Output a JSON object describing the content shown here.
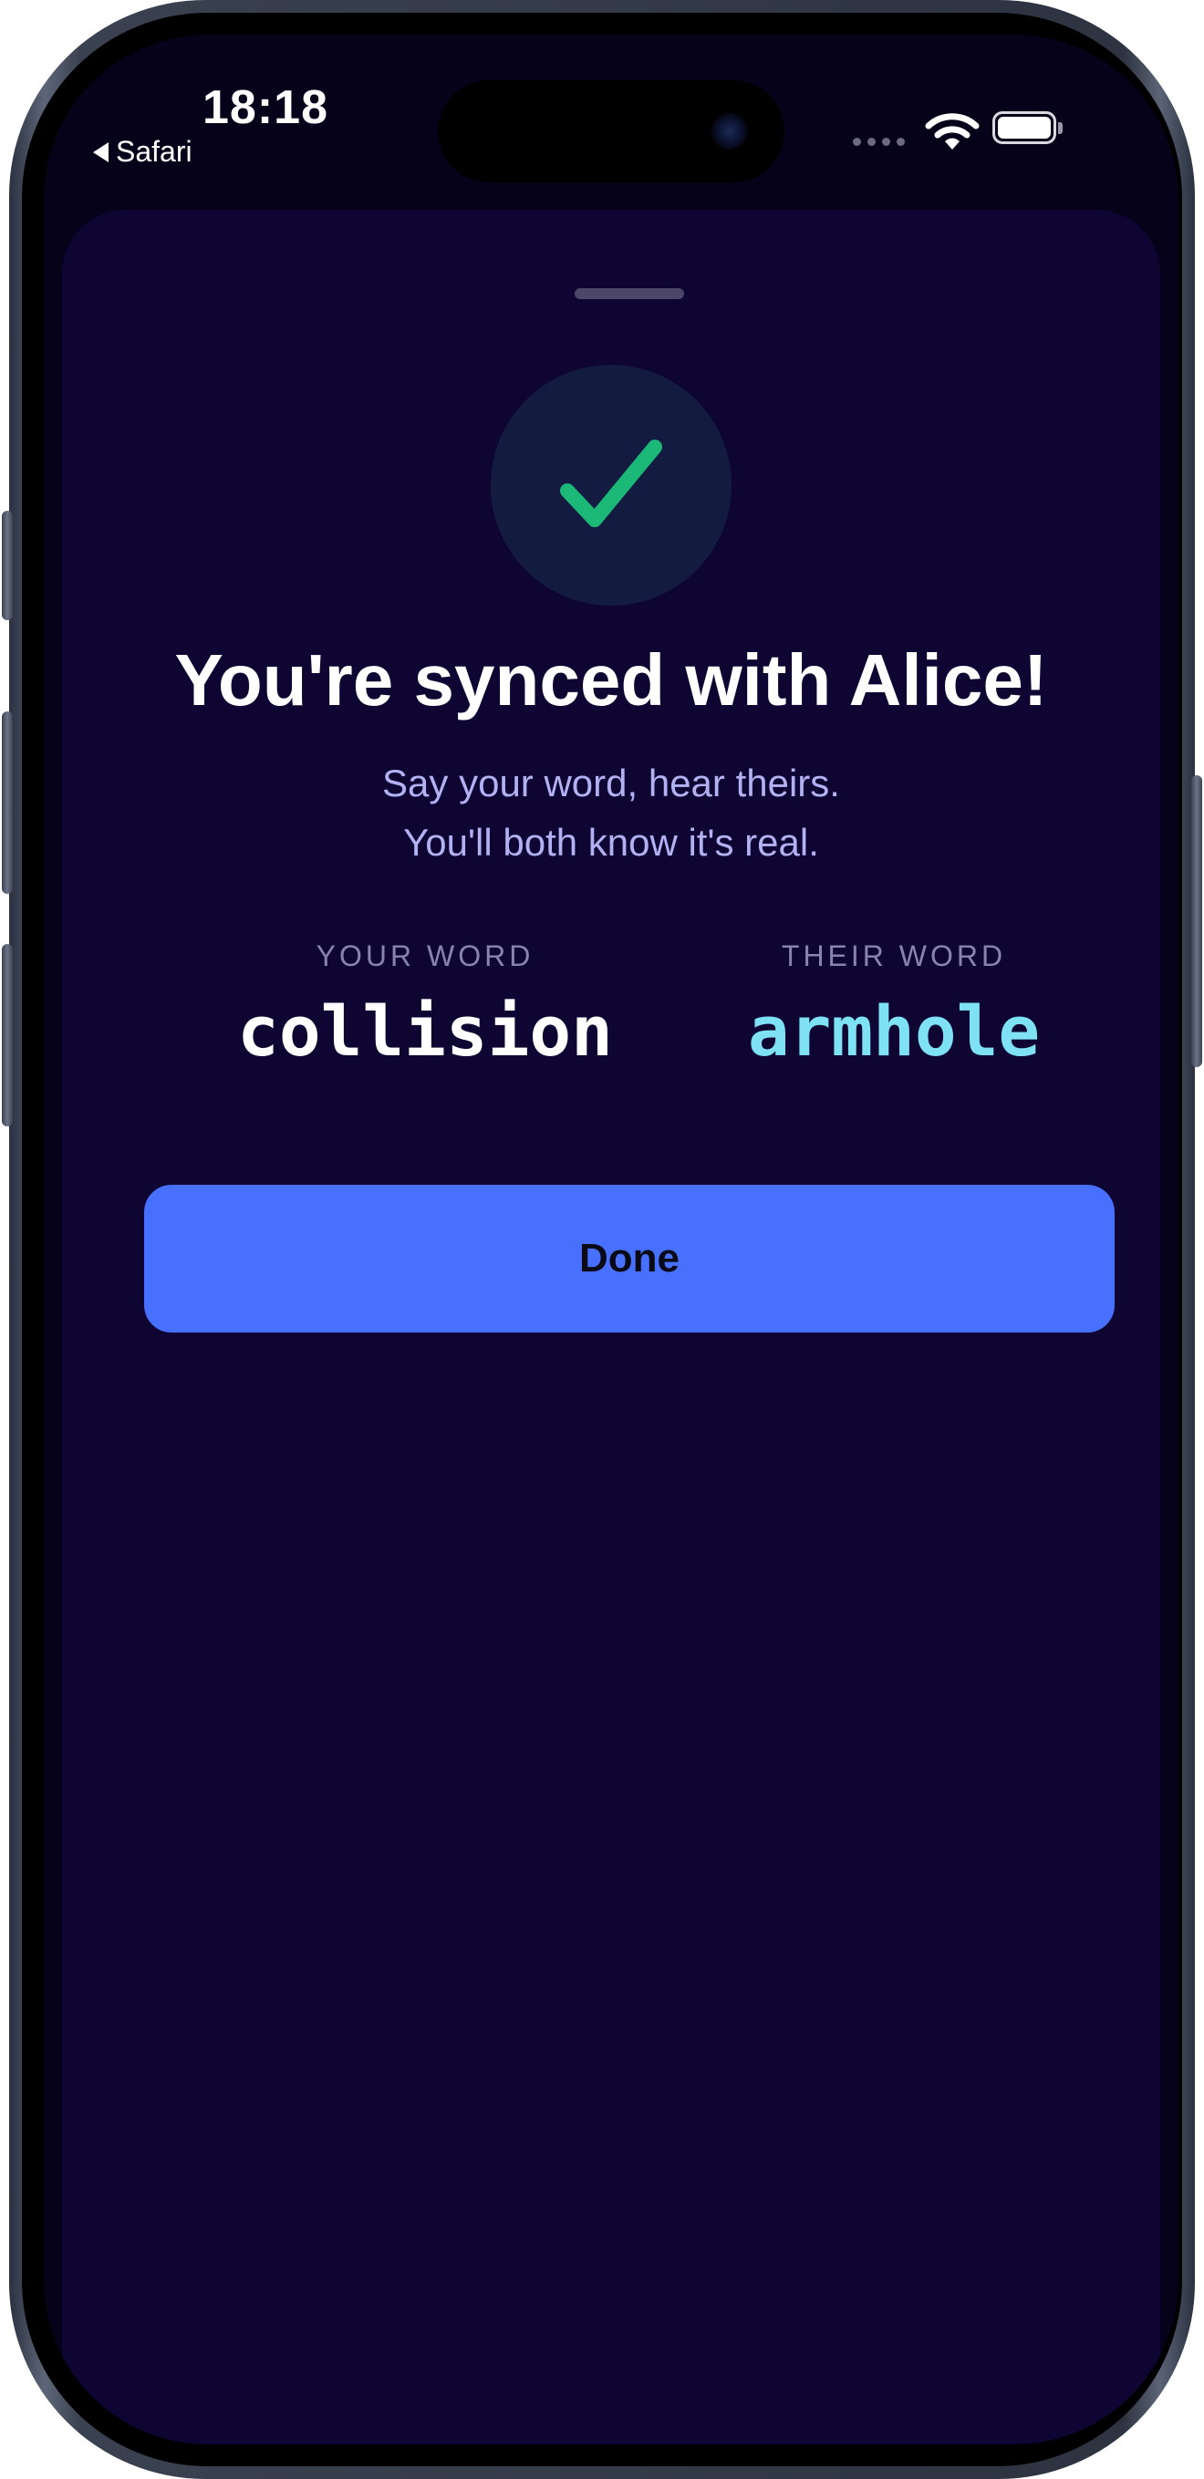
{
  "status_bar": {
    "time": "18:18",
    "back_app": "Safari",
    "icons": [
      "signal-dots-icon",
      "wifi-icon",
      "battery-icon"
    ]
  },
  "sheet": {
    "title": "You're synced with Alice!",
    "subtitle_line1": "Say your word, hear theirs.",
    "subtitle_line2": "You'll both know it's real.",
    "your_word_label": "YOUR WORD",
    "your_word": "collision",
    "their_word_label": "THEIR WORD",
    "their_word": "armhole",
    "done_label": "Done"
  },
  "colors": {
    "sheet_background": "#0f0533",
    "check_green": "#1bb877",
    "accent_button": "#4770ff",
    "their_word": "#7fe2f4",
    "subtitle": "#b2b1f2"
  }
}
